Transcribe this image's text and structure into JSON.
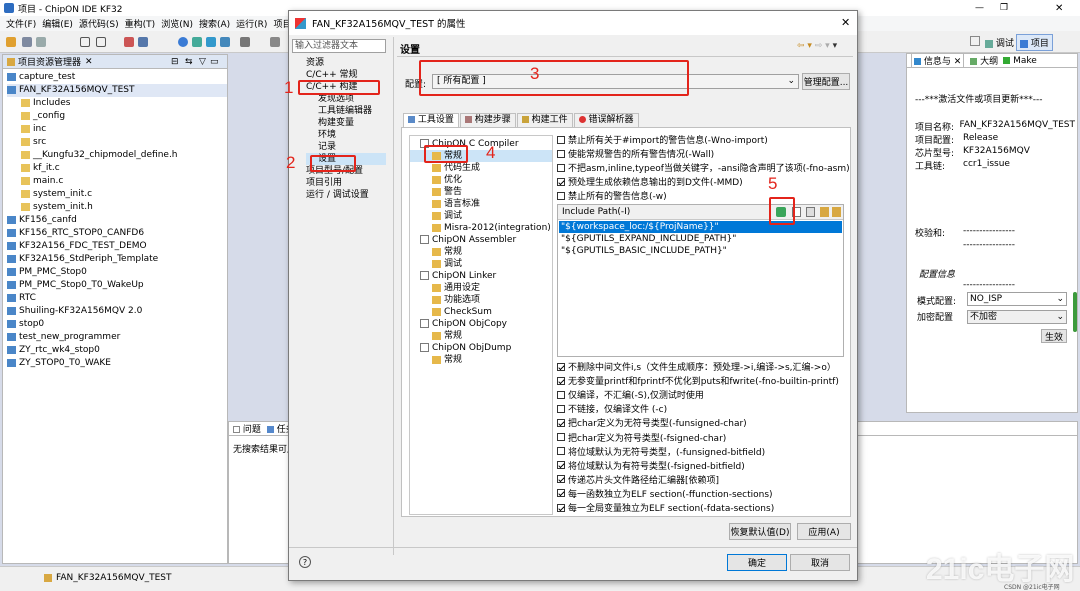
{
  "window": {
    "title": "项目 - ChipON IDE KF32"
  },
  "menu": [
    "文件(F)",
    "编辑(E)",
    "源代码(S)",
    "重构(T)",
    "浏览(N)",
    "搜索(A)",
    "运行(R)",
    "项目(P"
  ],
  "perspectives": {
    "debug": "调试",
    "project": "项目"
  },
  "explorer": {
    "title": "项目资源管理器",
    "items": [
      {
        "label": "capture_test",
        "level": 0
      },
      {
        "label": "FAN_KF32A156MQV_TEST",
        "level": 0
      },
      {
        "label": "Includes",
        "level": 1
      },
      {
        "label": "_config",
        "level": 1
      },
      {
        "label": "inc",
        "level": 1
      },
      {
        "label": "src",
        "level": 1
      },
      {
        "label": "__Kungfu32_chipmodel_define.h",
        "level": 1
      },
      {
        "label": "kf_it.c",
        "level": 1
      },
      {
        "label": "main.c",
        "level": 1
      },
      {
        "label": "system_init.c",
        "level": 1
      },
      {
        "label": "system_init.h",
        "level": 1
      },
      {
        "label": "KF156_canfd",
        "level": 0
      },
      {
        "label": "KF156_RTC_STOP0_CANFD6",
        "level": 0
      },
      {
        "label": "KF32A156_FDC_TEST_DEMO",
        "level": 0
      },
      {
        "label": "KF32A156_StdPeriph_Template",
        "level": 0
      },
      {
        "label": "PM_PMC_Stop0",
        "level": 0
      },
      {
        "label": "PM_PMC_Stop0_T0_WakeUp",
        "level": 0
      },
      {
        "label": "RTC",
        "level": 0
      },
      {
        "label": "Shuiling-KF32A156MQV 2.0",
        "level": 0
      },
      {
        "label": "stop0",
        "level": 0
      },
      {
        "label": "test_new_programmer",
        "level": 0
      },
      {
        "label": "ZY_rtc_wk4_stop0",
        "level": 0
      },
      {
        "label": "ZY_STOP0_T0_WAKE",
        "level": 0
      }
    ]
  },
  "info": {
    "tabs": [
      "信息与",
      "大纲",
      "Make"
    ],
    "update": "---***激活文件或项目更新***---",
    "rows": [
      [
        "项目名称:",
        "FAN_KF32A156MQV_TEST"
      ],
      [
        "项目配置:",
        "Release"
      ],
      [
        "芯片型号:",
        "KF32A156MQV"
      ],
      [
        "工具链:",
        "ccr1_issue"
      ]
    ],
    "checksum_label": "校验和:",
    "dashes": "----------------",
    "config_title": "配置信息",
    "mode_label": "模式配置:",
    "mode_value": "NO_ISP",
    "enc_label": "加密配置",
    "enc_value": "不加密",
    "apply": "生效"
  },
  "bottom": {
    "tabs": [
      "问题",
      "任务"
    ],
    "text": "无搜索结果可用"
  },
  "status": {
    "project": "FAN_KF32A156MQV_TEST"
  },
  "watermark": {
    "brand": "21ic电子网",
    "site": "CSDN @21ic电子网"
  },
  "dialog": {
    "title": "FAN_KF32A156MQV_TEST 的属性",
    "filter_placeholder": "输入过滤器文本",
    "nav": [
      {
        "label": "资源",
        "level": 0
      },
      {
        "label": "C/C++ 常规",
        "level": 0
      },
      {
        "label": "C/C++ 构建",
        "level": 0
      },
      {
        "label": "发现选项",
        "level": 1
      },
      {
        "label": "工具链编辑器",
        "level": 1
      },
      {
        "label": "构建变量",
        "level": 1
      },
      {
        "label": "环境",
        "level": 1
      },
      {
        "label": "记录",
        "level": 1
      },
      {
        "label": "设置",
        "level": 1
      },
      {
        "label": "项目型号/配置",
        "level": 0
      },
      {
        "label": "项目引用",
        "level": 0
      },
      {
        "label": "运行 / 调试设置",
        "level": 0
      }
    ],
    "heading": "设置",
    "config_label": "配置:",
    "config_value": "[ 所有配置 ]",
    "manage": "管理配置...",
    "tabs": [
      "工具设置",
      "构建步骤",
      "构建工件",
      "错误解析器"
    ],
    "tools": [
      {
        "label": "ChipON C Compiler",
        "level": 0
      },
      {
        "label": "常规",
        "level": 1
      },
      {
        "label": "代码生成",
        "level": 1
      },
      {
        "label": "优化",
        "level": 1
      },
      {
        "label": "警告",
        "level": 1
      },
      {
        "label": "语言标准",
        "level": 1
      },
      {
        "label": "调试",
        "level": 1
      },
      {
        "label": "Misra-2012(integration)",
        "level": 1
      },
      {
        "label": "ChipON Assembler",
        "level": 0
      },
      {
        "label": "常规",
        "level": 1
      },
      {
        "label": "调试",
        "level": 1
      },
      {
        "label": "ChipON Linker",
        "level": 0
      },
      {
        "label": "通用设定",
        "level": 1
      },
      {
        "label": "功能选项",
        "level": 1
      },
      {
        "label": "CheckSum",
        "level": 1
      },
      {
        "label": "ChipON ObjCopy",
        "level": 0
      },
      {
        "label": "常规",
        "level": 1
      },
      {
        "label": "ChipON ObjDump",
        "level": 0
      },
      {
        "label": "常规",
        "level": 1
      }
    ],
    "top_opts": [
      {
        "label": "禁止所有关于#import的警告信息(-Wno-import)",
        "checked": false
      },
      {
        "label": "使能常规警告的所有警告情况(-Wall)",
        "checked": false
      },
      {
        "label": "不把asm,inline,typeof当做关键字，-ansi隐含声明了该项(-fno-asm)",
        "checked": false
      },
      {
        "label": "预处理生成依赖信息输出的到D文件(-MMD)",
        "checked": true
      },
      {
        "label": "禁止所有的警告信息(-w)",
        "checked": false
      }
    ],
    "include_title": "Include Path(-I)",
    "include_paths": [
      "\"${workspace_loc:/${ProjName}}\"",
      "\"${GPUTILS_EXPAND_INCLUDE_PATH}\"",
      "\"${GPUTILS_BASIC_INCLUDE_PATH}\""
    ],
    "bottom_opts": [
      {
        "label": "不删除中间文件i,s（文件生成顺序：预处理->i,编译->s,汇编->o）",
        "checked": true
      },
      {
        "label": "无参变量printf和fprintf不优化到puts和fwrite(-fno-builtin-printf)",
        "checked": true
      },
      {
        "label": "仅编译，不汇编(-S),仅测试时使用",
        "checked": false
      },
      {
        "label": "不链接，仅编译文件 (-c)",
        "checked": false
      },
      {
        "label": "把char定义为无符号类型(-funsigned-char)",
        "checked": true
      },
      {
        "label": "把char定义为符号类型(-fsigned-char)",
        "checked": false
      },
      {
        "label": "将位域默认为无符号类型，(-funsigned-bitfield)",
        "checked": false
      },
      {
        "label": "将位域默认为有符号类型(-fsigned-bitfield)",
        "checked": true
      },
      {
        "label": "传递芯片头文件路径给汇编器[依赖项]",
        "checked": true
      },
      {
        "label": "每一函数独立为ELF section(-ffunction-sections)",
        "checked": true
      },
      {
        "label": "每一全局变量独立为ELF section(-fdata-sections)",
        "checked": true
      }
    ],
    "restore": "恢复默认值(D)",
    "apply": "应用(A)",
    "ok": "确定",
    "cancel": "取消",
    "help": "?"
  },
  "annotations": [
    "1",
    "2",
    "3",
    "4",
    "5"
  ]
}
